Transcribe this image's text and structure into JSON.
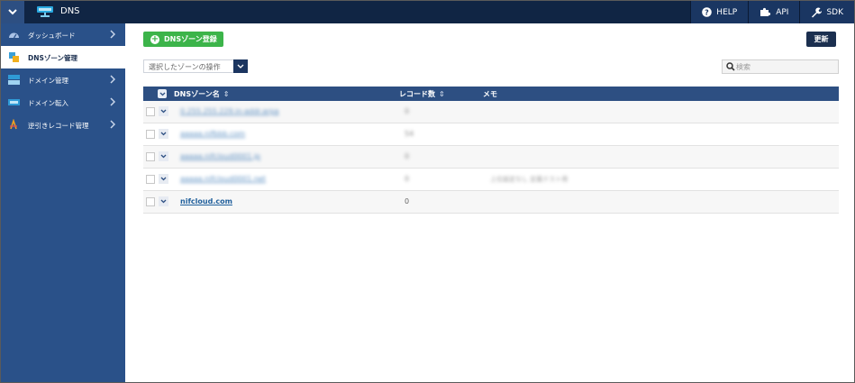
{
  "header": {
    "app_title": "DNS",
    "actions": [
      {
        "label": "HELP",
        "icon": "question-circle-icon"
      },
      {
        "label": "API",
        "icon": "puzzle-icon"
      },
      {
        "label": "SDK",
        "icon": "wrench-icon"
      }
    ]
  },
  "sidebar": {
    "items": [
      {
        "label": "ダッシュボード",
        "icon": "dashboard-gauge-icon",
        "active": false,
        "has_chevron": true
      },
      {
        "label": "DNSゾーン管理",
        "icon": "dns-zone-icon",
        "active": true,
        "has_chevron": false
      },
      {
        "label": "ドメイン管理",
        "icon": "domain-management-icon",
        "active": false,
        "has_chevron": true
      },
      {
        "label": "ドメイン転入",
        "icon": "domain-transfer-icon",
        "active": false,
        "has_chevron": true
      },
      {
        "label": "逆引きレコード管理",
        "icon": "reverse-record-icon",
        "active": false,
        "has_chevron": true
      }
    ]
  },
  "toolbar": {
    "add_label": "DNSゾーン登録",
    "refresh_label": "更新",
    "operation_select_label": "選択したゾーンの操作",
    "search_placeholder": "検索"
  },
  "table": {
    "columns": [
      "DNSゾーン名",
      "レコード数",
      "メモ"
    ],
    "rows": [
      {
        "name": "0.255.255.229.in-addr.arpa",
        "count": "0",
        "memo": "",
        "obscured": true
      },
      {
        "name": "aaaaa.nifbbb.com",
        "count": "54",
        "memo": "",
        "obscured": true
      },
      {
        "name": "aaaaa.nifcloud0001.jp",
        "count": "0",
        "memo": "",
        "obscured": true
      },
      {
        "name": "aaaaa.nifcloud0001.net",
        "count": "0",
        "memo": "上位設定なし 定義テスト用",
        "obscured": true
      },
      {
        "name": "nifcloud.com",
        "count": "0",
        "memo": "",
        "obscured": false
      }
    ]
  },
  "colors": {
    "topbar": "#102544",
    "sidebar": "#2a5189",
    "add_button": "#3cb44a",
    "table_header": "#2d4f82",
    "link": "#1f5f9c"
  }
}
